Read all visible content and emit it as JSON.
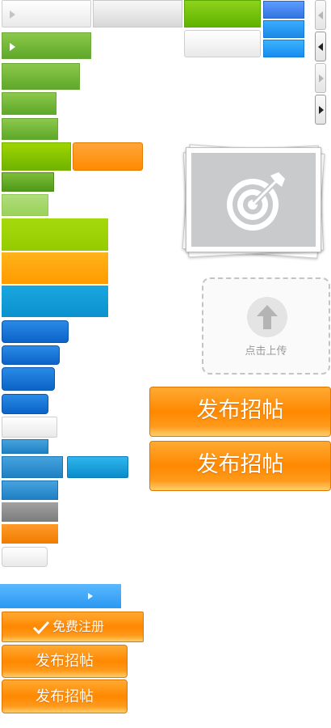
{
  "buttons": {
    "post_large_1": "发布招帖",
    "post_large_2": "发布招帖",
    "register": "免费注册",
    "post_small_1": "发布招帖",
    "post_small_2": "发布招帖"
  },
  "upload": {
    "label": "点击上传"
  },
  "icons": {
    "play": "play-arrow-icon",
    "arrow_left": "arrow-left-icon",
    "arrow_right": "arrow-right-icon",
    "check": "check-icon",
    "target": "target-icon",
    "upload": "upload-arrow-icon"
  },
  "colors": {
    "orange": "#ff8a00",
    "green": "#6fb400",
    "blue": "#0b91cf",
    "gray_text": "#999999"
  }
}
